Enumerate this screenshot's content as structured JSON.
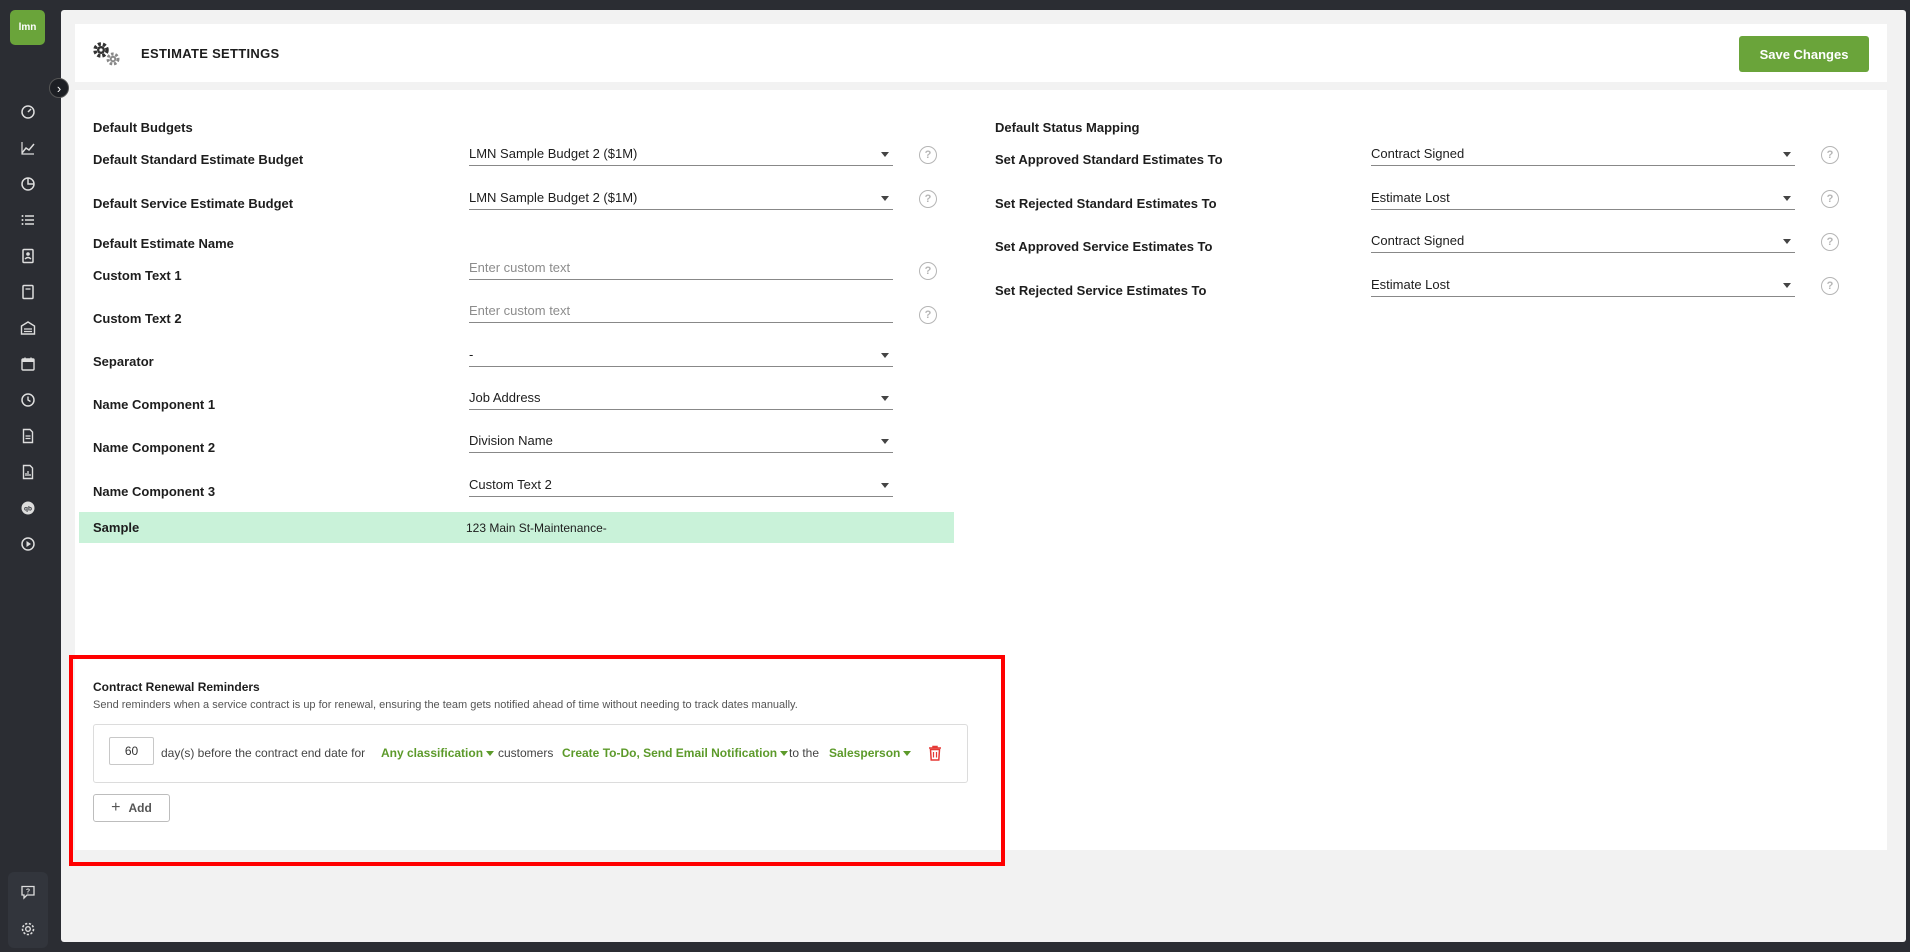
{
  "app": {
    "logo_text": "lmn"
  },
  "rail": {
    "icons": [
      "dashboard-icon",
      "chart-line-icon",
      "pie-chart-icon",
      "list-icon",
      "contacts-icon",
      "estimate-icon",
      "warehouse-icon",
      "calendar-icon",
      "clock-icon",
      "document-icon",
      "report-icon",
      "qb-icon",
      "play-icon"
    ],
    "bottom_icons": [
      "help-chat-icon",
      "settings-gear-icon"
    ]
  },
  "header": {
    "title": "ESTIMATE SETTINGS",
    "save_label": "Save Changes"
  },
  "budgets": {
    "section_title": "Default Budgets",
    "standard_label": "Default Standard Estimate Budget",
    "standard_value": "LMN Sample Budget 2 ($1M)",
    "service_label": "Default Service Estimate Budget",
    "service_value": "LMN Sample Budget 2 ($1M)"
  },
  "estimate_name": {
    "section_title": "Default Estimate Name",
    "custom1_label": "Custom Text 1",
    "custom1_placeholder": "Enter custom text",
    "custom2_label": "Custom Text 2",
    "custom2_placeholder": "Enter custom text",
    "separator_label": "Separator",
    "separator_value": "-",
    "comp1_label": "Name Component 1",
    "comp1_value": "Job Address",
    "comp2_label": "Name Component 2",
    "comp2_value": "Division Name",
    "comp3_label": "Name Component 3",
    "comp3_value": "Custom Text 2",
    "sample_label": "Sample",
    "sample_value": "123 Main St-Maintenance-"
  },
  "status_mapping": {
    "section_title": "Default Status Mapping",
    "approved_standard_label": "Set Approved Standard Estimates To",
    "approved_standard_value": "Contract Signed",
    "rejected_standard_label": "Set Rejected Standard Estimates To",
    "rejected_standard_value": "Estimate Lost",
    "approved_service_label": "Set Approved Service Estimates To",
    "approved_service_value": "Contract Signed",
    "rejected_service_label": "Set Rejected Service Estimates To",
    "rejected_service_value": "Estimate Lost"
  },
  "renewal": {
    "title": "Contract Renewal Reminders",
    "description": "Send reminders when a service contract is up for renewal, ensuring the team gets notified ahead of time without needing to track dates manually.",
    "days_value": "60",
    "text_before": "day(s) before the contract end date for",
    "classification": "Any classification",
    "text_customers": "customers",
    "actions": "Create To-Do, Send Email Notification",
    "text_to_the": "to the",
    "recipient": "Salesperson",
    "add_label": "Add"
  },
  "colors": {
    "brand_green": "#6aa43a",
    "link_green": "#5c9a2a",
    "sample_bg": "#c9f2d9",
    "highlight_red": "#ff0000",
    "trash_red": "#e53935"
  }
}
